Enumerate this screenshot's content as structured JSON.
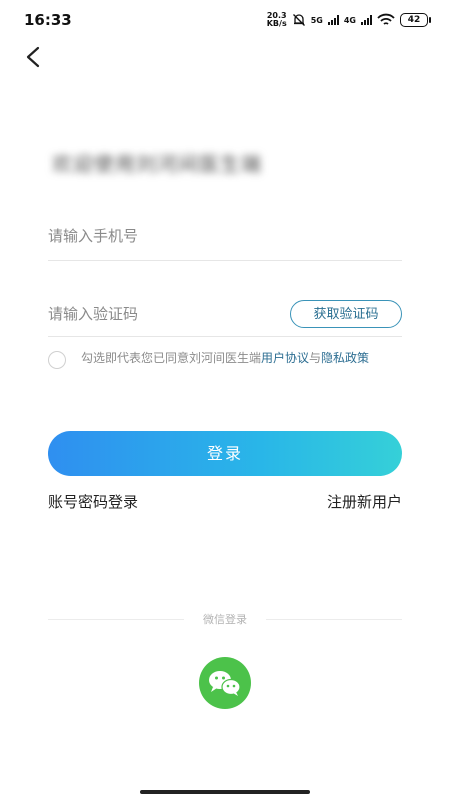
{
  "status_bar": {
    "time": "16:33",
    "net_speed_value": "20.3",
    "net_speed_unit": "KB/s",
    "network_1": "5G",
    "network_2": "4G",
    "battery": "42"
  },
  "banner": {
    "blurred_text": "欢迎使用刘河间医生端"
  },
  "form": {
    "phone_placeholder": "请输入手机号",
    "phone_value": "",
    "code_placeholder": "请输入验证码",
    "code_value": "",
    "get_code_label": "获取验证码"
  },
  "agreement": {
    "checked": false,
    "prefix": "勾选即代表您已同意刘河间医生端",
    "user_agreement": "用户协议",
    "conjunction": "与",
    "privacy_policy": "隐私政策"
  },
  "actions": {
    "login_label": "登录",
    "password_login": "账号密码登录",
    "register": "注册新用户"
  },
  "social": {
    "wechat_label": "微信登录"
  },
  "icons": {
    "back": "back-arrow-icon",
    "wechat": "wechat-icon",
    "mute": "bell-off-icon",
    "wifi": "wifi-icon"
  },
  "colors": {
    "accent_start": "#2f8ff0",
    "accent_end": "#35d0d8",
    "link": "#2d6e92",
    "wechat_green": "#4cc24a"
  }
}
